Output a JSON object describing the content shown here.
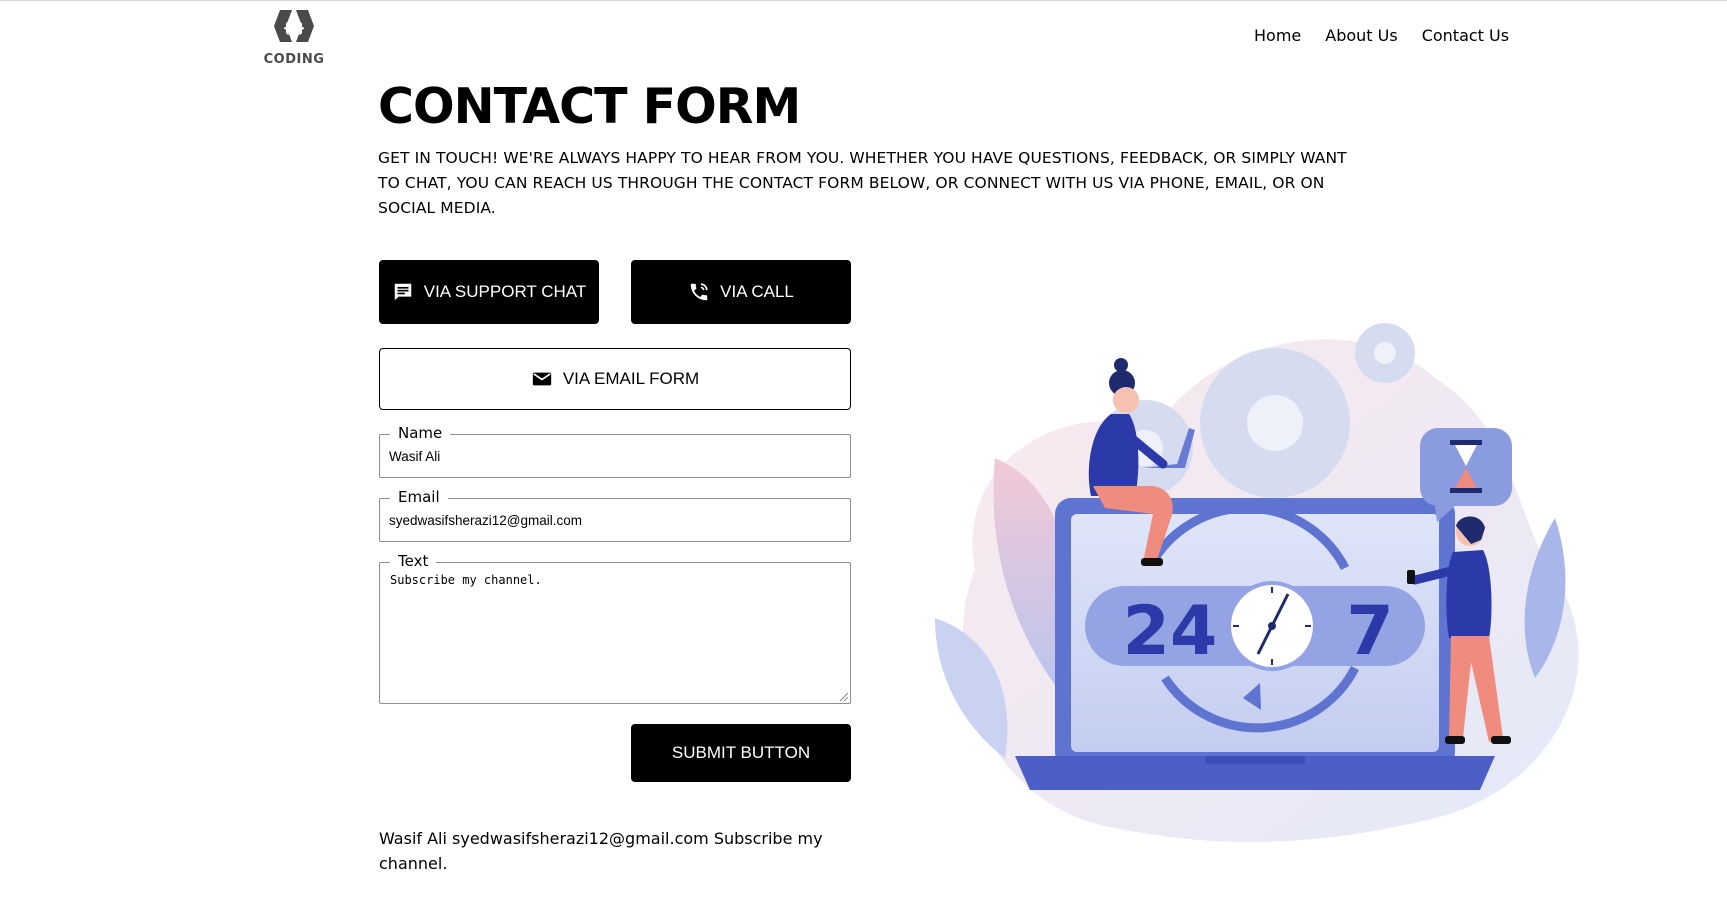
{
  "brand": {
    "name": "CODING",
    "logo_icon": "code-braces-icon"
  },
  "nav": {
    "items": [
      {
        "label": "Home"
      },
      {
        "label": "About Us"
      },
      {
        "label": "Contact Us"
      }
    ]
  },
  "page": {
    "title": "CONTACT FORM",
    "description": "GET IN TOUCH! WE'RE ALWAYS HAPPY TO HEAR FROM YOU. WHETHER YOU HAVE QUESTIONS, FEEDBACK, OR SIMPLY WANT TO CHAT, YOU CAN REACH US THROUGH THE CONTACT FORM BELOW, OR CONNECT WITH US VIA PHONE, EMAIL, OR ON SOCIAL MEDIA."
  },
  "buttons": {
    "chat": {
      "label": "VIA SUPPORT CHAT",
      "icon": "message-icon"
    },
    "call": {
      "label": "VIA CALL",
      "icon": "phone-icon"
    },
    "email": {
      "label": "VIA EMAIL FORM",
      "icon": "mail-icon"
    },
    "submit": {
      "label": "SUBMIT BUTTON"
    }
  },
  "form": {
    "name": {
      "label": "Name",
      "value": "Wasif Ali"
    },
    "email": {
      "label": "Email",
      "value": "syedwasifsherazi12@gmail.com"
    },
    "text": {
      "label": "Text",
      "value": "Subscribe my channel."
    }
  },
  "output": {
    "text": "Wasif Ali syedwasifsherazi12@gmail.com Subscribe my channel."
  },
  "illustration": {
    "big_number_left": "24",
    "big_number_right": "7",
    "colors": {
      "primary": "#2b3aa8",
      "light": "#c9d2f0",
      "accent": "#f08c7e",
      "dark": "#000000"
    }
  }
}
